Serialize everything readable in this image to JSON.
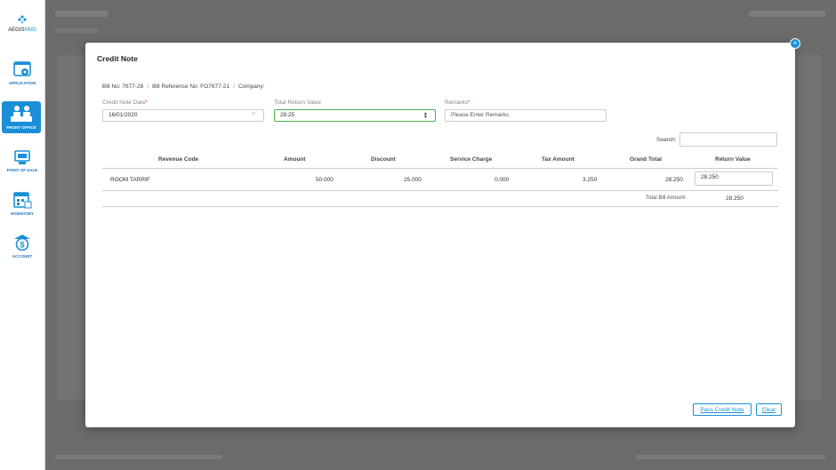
{
  "app": {
    "logo_prefix": "AEGIS",
    "logo_suffix": "HMS"
  },
  "sidebar": {
    "items": [
      {
        "label": "APPLICATION",
        "icon": "application-gear-icon"
      },
      {
        "label": "FRONT OFFICE",
        "icon": "front-office-desk-icon",
        "active": true
      },
      {
        "label": "POINT OF SALE",
        "icon": "point-of-sale-icon"
      },
      {
        "label": "INVENTORY",
        "icon": "inventory-icon"
      },
      {
        "label": "ACCOUNT",
        "icon": "account-dollar-icon"
      }
    ]
  },
  "modal": {
    "title": "Credit Note",
    "close_glyph": "×",
    "bill_no": "Bill No: 7677-28",
    "bill_reference": "Bill Reference No: FO7677-21",
    "company": "Company:",
    "credit_note_date_label": "Credit Note Date",
    "credit_note_date_value": "16/01/2020",
    "total_return_label": "Total Return Value",
    "total_return_value": "28.25",
    "remarks_label": "Remarks",
    "remarks_placeholder": "Please Enter Remarks",
    "required_mark": "*",
    "search_label": "Search:",
    "search_value": ""
  },
  "table": {
    "headers": [
      "Revenue Code",
      "Amount",
      "Discount",
      "Service Charge",
      "Tax Amount",
      "Grand Total",
      "Return Value"
    ],
    "rows": [
      {
        "revenue_code": "ROOM TARRIF",
        "amount": "50.000",
        "discount": "25.000",
        "service_charge": "0.000",
        "tax_amount": "3.250",
        "grand_total": "28.250",
        "return_value": "28.250"
      }
    ],
    "total_label": "Total Bill Amount",
    "total_value": "28.250"
  },
  "buttons": {
    "pass_credit_note": "Pass Credit Note",
    "clear": "Clear"
  },
  "colors": {
    "accent": "#1a8fd8",
    "focus": "#4caf50",
    "required": "#e0322d"
  }
}
